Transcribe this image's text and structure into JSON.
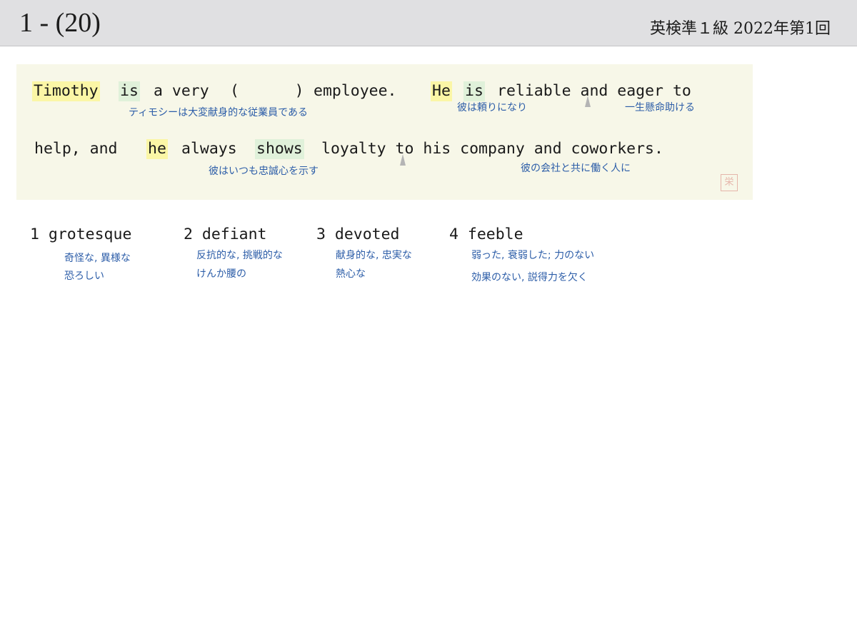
{
  "header": {
    "question_number": "1 - (20)",
    "exam_title": "英検準１級  2022年第1回"
  },
  "sentence": {
    "line1": {
      "timothy": "Timothy",
      "is": "is",
      "a_very": "a very",
      "blank": "(      )",
      "employee": "employee.",
      "he": "He",
      "is2": "is",
      "rest": "reliable and eager to"
    },
    "line2": {
      "help_and": "help, and",
      "he": "he",
      "always": "always",
      "shows": "shows",
      "rest": "loyalty to his company and coworkers."
    },
    "glosses": {
      "g1": "ティモシーは大変献身的な従業員である",
      "g2": "彼は頼りになり",
      "g3": "一生懸命助ける",
      "g4": "彼はいつも忠誠心を示す",
      "g5": "彼の会社と共に働く人に"
    },
    "seal_glyph": "栄"
  },
  "choices": [
    {
      "label": "1 grotesque",
      "gloss_1": "奇怪な, 異様な",
      "gloss_2": "恐ろしい"
    },
    {
      "label": "2 defiant",
      "gloss_1": "反抗的な, 挑戦的な",
      "gloss_2": "けんか腰の"
    },
    {
      "label": "3 devoted",
      "gloss_1": "献身的な, 忠実な",
      "gloss_2": "熱心な"
    },
    {
      "label": "4 feeble",
      "gloss_1": "弱った, 衰弱した; 力のない",
      "gloss_2": "効果のない, 説得力を欠く"
    }
  ]
}
